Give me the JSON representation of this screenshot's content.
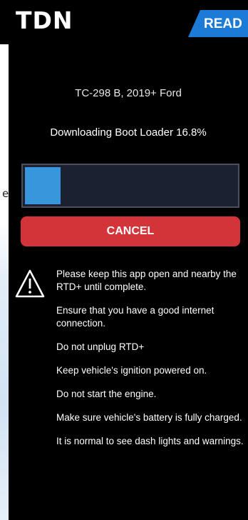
{
  "header": {
    "logo": "TDN",
    "status_tab": "READ"
  },
  "left_edge_glyph": "e",
  "device": {
    "title": "TC-298 B, 2019+ Ford"
  },
  "download": {
    "status": "Downloading Boot Loader 16.8%",
    "progress_percent": 16.8
  },
  "actions": {
    "cancel_label": "CANCEL"
  },
  "colors": {
    "accent_blue": "#1c7bd6",
    "progress_fill": "#3896dd",
    "cancel_red": "#d3343a"
  },
  "warning": {
    "icon": "warning-triangle-icon",
    "items": [
      "Please keep this app open and nearby the RTD+ until complete.",
      "Ensure that you have a good internet connection.",
      "Do not unplug RTD+",
      "Keep vehicle's ignition powered on.",
      "Do not start the engine.",
      "Make sure vehicle's battery is fully charged.",
      "It is normal to see dash lights and warnings."
    ]
  }
}
